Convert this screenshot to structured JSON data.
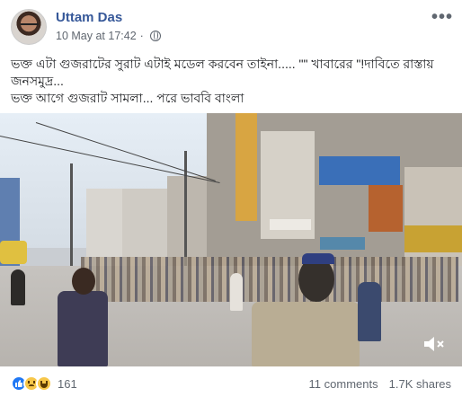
{
  "post": {
    "author": "Uttam Das",
    "timestamp": "10 May at 17:42",
    "separator": "·",
    "privacy_icon": "globe-icon",
    "more_icon": "more-options-icon",
    "text_lines": [
      "ভক্ত এটা গুজরাটের সুরাট এটাই মডেল করবেন তাইনা..... \"\" খাবারের \"!দাবিতে রাস্তায় জনসমুদ্র...",
      "ভক্ত আগে গুজরাট সামলা... পরে ভাববি বাংলা"
    ]
  },
  "video": {
    "mute_icon": "speaker-muted-icon"
  },
  "footer": {
    "reaction_icons": [
      "like-icon",
      "sad-icon",
      "haha-icon"
    ],
    "reaction_count": "161",
    "comments": "11 comments",
    "shares": "1.7K shares"
  }
}
